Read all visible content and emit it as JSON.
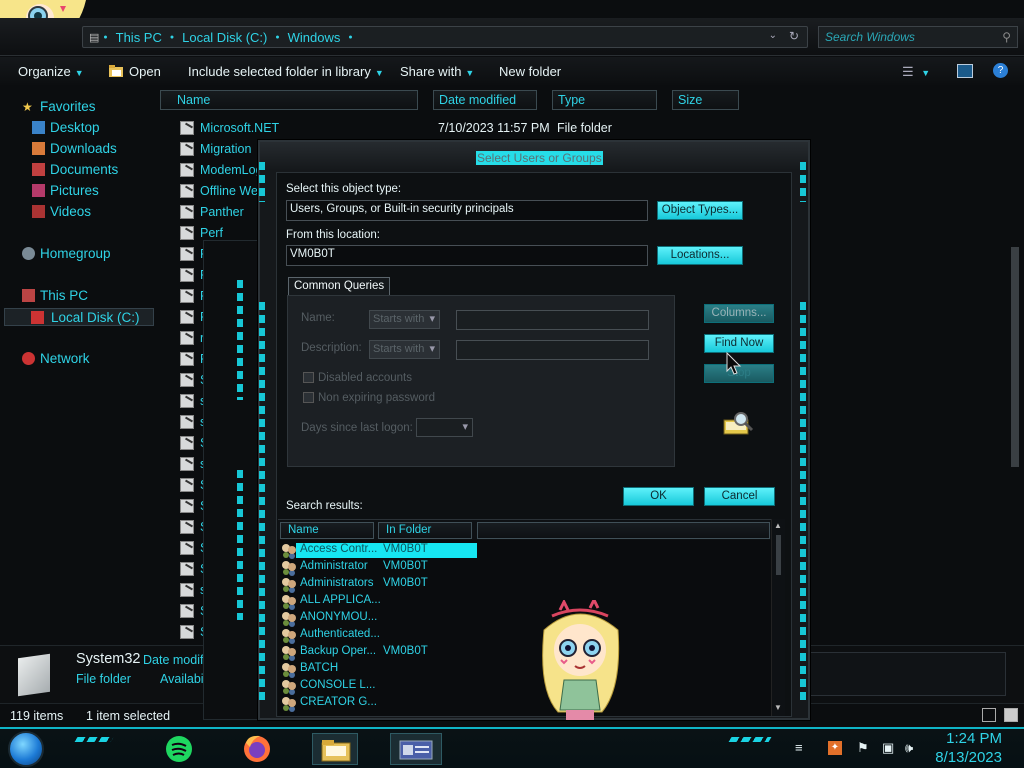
{
  "explorer": {
    "breadcrumbs": [
      "This PC",
      "Local Disk (C:)",
      "Windows"
    ],
    "search_placeholder": "Search Windows",
    "toolbar": {
      "organize": "Organize",
      "open": "Open",
      "include": "Include selected folder in library",
      "share": "Share with",
      "new_folder": "New folder"
    },
    "nav": {
      "favorites": "Favorites",
      "desktop": "Desktop",
      "downloads": "Downloads",
      "documents": "Documents",
      "pictures": "Pictures",
      "videos": "Videos",
      "homegroup": "Homegroup",
      "this_pc": "This PC",
      "local_disk": "Local Disk (C:)",
      "network": "Network"
    },
    "columns": [
      "Name",
      "Date modified",
      "Type",
      "Size"
    ],
    "first_row": {
      "name": "Microsoft.NET",
      "date": "7/10/2023 11:57 PM",
      "type": "File folder"
    },
    "files": [
      "Migration",
      "ModemLog",
      "Offline Web",
      "Panther",
      "Perf",
      "P",
      "P",
      "P",
      "Re",
      "re",
      "Re",
      "Sc",
      "sc",
      "se",
      "Se",
      "se",
      "Se",
      "Sh",
      "Sk",
      "Sc",
      "Sp",
      "ss",
      "Sy",
      "Sy"
    ],
    "details": {
      "name": "System32",
      "type": "File folder",
      "date_label": "Date modif",
      "avail_label": "Availabi"
    },
    "status": {
      "count": "119 items",
      "selected": "1 item selected"
    }
  },
  "dialog": {
    "title": "Select Users or Groups",
    "object_type_label": "Select this object type:",
    "object_type_value": "Users, Groups, or Built-in security principals",
    "object_types_button": "Object Types...",
    "location_label": "From this location:",
    "location_value": "VM0B0T",
    "locations_button": "Locations...",
    "tab_common": "Common Queries",
    "name_label": "Name:",
    "description_label": "Description:",
    "starts_with": "Starts with",
    "disabled_accounts": "Disabled accounts",
    "non_expiring": "Non expiring password",
    "days_since": "Days since last logon:",
    "columns_button": "Columns...",
    "find_now_button": "Find Now",
    "stop_button": "Stop",
    "ok_button": "OK",
    "cancel_button": "Cancel",
    "search_results_label": "Search results:",
    "results_columns": [
      "Name",
      "In Folder"
    ],
    "results": [
      {
        "name": "Access Contr...",
        "folder": "VM0B0T"
      },
      {
        "name": "Administrator",
        "folder": "VM0B0T"
      },
      {
        "name": "Administrators",
        "folder": "VM0B0T"
      },
      {
        "name": "ALL APPLICA...",
        "folder": ""
      },
      {
        "name": "ANONYMOU...",
        "folder": ""
      },
      {
        "name": "Authenticated...",
        "folder": ""
      },
      {
        "name": "Backup Oper...",
        "folder": "VM0B0T"
      },
      {
        "name": "BATCH",
        "folder": ""
      },
      {
        "name": "CONSOLE L...",
        "folder": ""
      },
      {
        "name": "CREATOR G...",
        "folder": ""
      }
    ]
  },
  "taskbar": {
    "time": "1:24 PM",
    "date": "8/13/2023"
  },
  "colors": {
    "accent": "#2fd3e6",
    "button": "#18c9da",
    "selection": "#16e6f2"
  }
}
